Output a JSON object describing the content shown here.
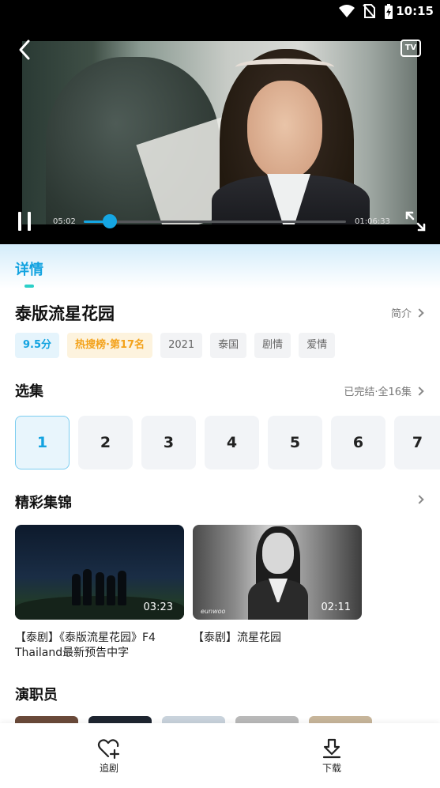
{
  "status_bar": {
    "time": "10:15"
  },
  "player": {
    "tv_label": "TV",
    "current_time": "05:02",
    "total_time": "01:06:33",
    "progress": 0.1
  },
  "detail": {
    "tab_label": "详情",
    "title": "泰版流星花园",
    "intro_label": "简介",
    "tags": [
      "9.5分",
      "热搜榜·第17名",
      "2021",
      "泰国",
      "剧情",
      "爱情"
    ]
  },
  "episodes": {
    "section_title": "选集",
    "status": "已完结·全16集",
    "items": [
      "1",
      "2",
      "3",
      "4",
      "5",
      "6",
      "7"
    ],
    "selected": "1"
  },
  "highlights": {
    "section_title": "精彩集锦",
    "clips": [
      {
        "duration": "03:23",
        "title": "【泰剧】《泰版流星花园》F4 Thailand最新预告中字"
      },
      {
        "duration": "02:11",
        "title": "【泰剧】流星花园",
        "watermark": "eunwoo"
      }
    ]
  },
  "cast": {
    "section_title": "演职员"
  },
  "bottom_bar": {
    "follow_label": "追剧",
    "download_label": "下载"
  },
  "colors": {
    "accent": "#13a3e0",
    "hot": "#f3a21a",
    "teal": "#2ad0c8"
  }
}
